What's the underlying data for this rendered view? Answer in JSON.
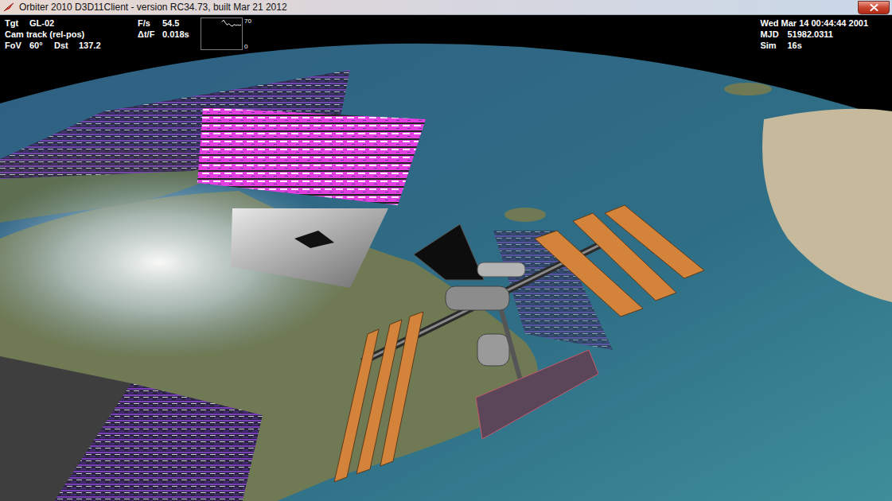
{
  "window": {
    "title": "Orbiter 2010 D3D11Client - version RC34.73, built Mar 21 2012"
  },
  "hud": {
    "target": [
      [
        "Tgt",
        "GL-02"
      ],
      [
        "Cam track (rel-pos)"
      ],
      [
        "FoV",
        "60°",
        "Dst",
        "137.2"
      ]
    ],
    "performance": [
      [
        "F/s",
        "54.5"
      ],
      [
        "Δt/F",
        "0.018s"
      ]
    ],
    "framerate_graph": {
      "max": "70",
      "min": "0",
      "values": [
        62,
        66,
        60,
        55,
        58,
        54,
        52,
        56,
        54,
        55,
        54,
        55
      ]
    },
    "time": [
      [
        "Wed Mar 14 00:44:44 2001"
      ],
      [
        "MJD",
        "51982.0311"
      ],
      [
        "Sim",
        "16s"
      ]
    ]
  }
}
